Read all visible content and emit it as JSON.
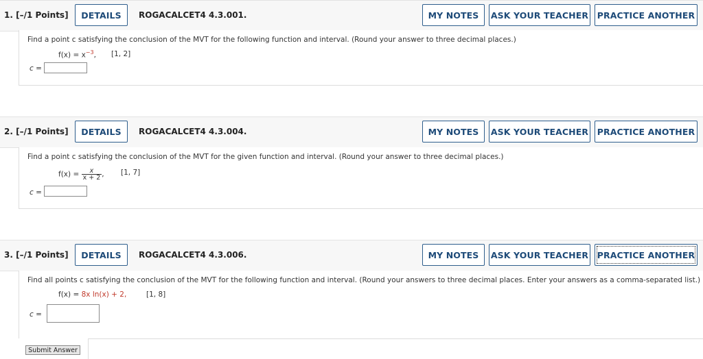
{
  "questions": [
    {
      "number": "1.",
      "points": "[–/1 Points]",
      "details_label": "DETAILS",
      "id": "ROGACALCET4 4.3.001.",
      "my_notes_label": "MY NOTES",
      "ask_label": "ASK YOUR TEACHER",
      "practice_label": "PRACTICE ANOTHER",
      "prompt": "Find a point c satisfying the conclusion of the MVT for the following function and interval. (Round your answer to three decimal places.)",
      "fx_prefix": "f(x) = x",
      "fx_exponent": "−3",
      "fx_suffix": ",",
      "interval": "[1, 2]",
      "c_label": "c ="
    },
    {
      "number": "2.",
      "points": "[–/1 Points]",
      "details_label": "DETAILS",
      "id": "ROGACALCET4 4.3.004.",
      "my_notes_label": "MY NOTES",
      "ask_label": "ASK YOUR TEACHER",
      "practice_label": "PRACTICE ANOTHER",
      "prompt": "Find a point  c  satisfying the conclusion of the MVT for the given function and interval. (Round your answer to three decimal places.)",
      "fx_prefix": "f(x) =",
      "frac_num": "x",
      "frac_den": "x + 2",
      "fx_suffix": ",",
      "interval": "[1, 7]",
      "c_label": "c ="
    },
    {
      "number": "3.",
      "points": "[–/1 Points]",
      "details_label": "DETAILS",
      "id": "ROGACALCET4 4.3.006.",
      "my_notes_label": "MY NOTES",
      "ask_label": "ASK YOUR TEACHER",
      "practice_label": "PRACTICE ANOTHER",
      "prompt": "Find all points c satisfying the conclusion of the MVT for the following function and interval. (Round your answers to three decimal places. Enter your answers as a comma-separated list.)",
      "fx_prefix": "f(x) =",
      "fx_body": "8x ln(x) + 2,",
      "interval": "[1, 8]",
      "c_label": "c =",
      "submit_label": "Submit Answer"
    }
  ]
}
